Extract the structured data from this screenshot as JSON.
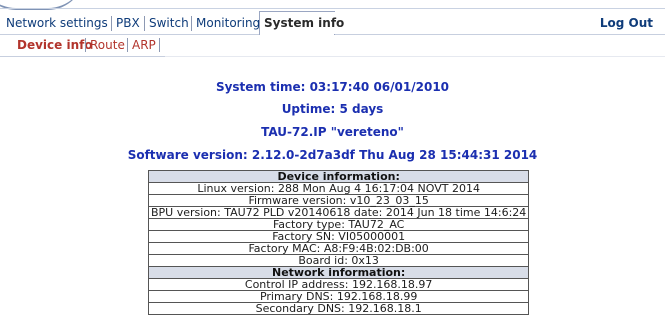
{
  "main_nav": {
    "tabs": [
      {
        "label": "Network settings"
      },
      {
        "label": "PBX"
      },
      {
        "label": "Switch"
      },
      {
        "label": "Monitoring"
      },
      {
        "label": "System info",
        "active": true
      }
    ],
    "logout_label": "Log Out"
  },
  "sub_nav": {
    "tabs": [
      {
        "label": "Device info",
        "active": true
      },
      {
        "label": "Route"
      },
      {
        "label": "ARP"
      }
    ]
  },
  "summary": {
    "system_time": "System time: 03:17:40  06/01/2010",
    "uptime": "Uptime: 5 days",
    "device_name": "TAU-72.IP \"vereteno\"",
    "software_version": "Software version: 2.12.0-2d7a3df Thu Aug 28 15:44:31 2014"
  },
  "device_information": {
    "header": "Device information:",
    "rows": [
      "Linux version: 288 Mon Aug 4 16:17:04 NOVT 2014",
      "Firmware version: v10_23_03_15",
      "BPU version: TAU72 PLD v20140618 date: 2014 Jun 18 time 14:6:24",
      "Factory type: TAU72_AC",
      "Factory SN: VI05000001",
      "Factory MAC: A8:F9:4B:02:DB:00",
      "Board id: 0x13"
    ]
  },
  "network_information": {
    "header": "Network information:",
    "rows": [
      "Control IP address: 192.168.18.97",
      "Primary DNS: 192.168.18.99",
      "Secondary DNS: 192.168.18.1"
    ]
  },
  "colors": {
    "nav_text": "#0f3c7a",
    "subnav_text": "#b2342c",
    "info_text": "#1b2fb0",
    "table_header_bg": "#d8dde8"
  }
}
